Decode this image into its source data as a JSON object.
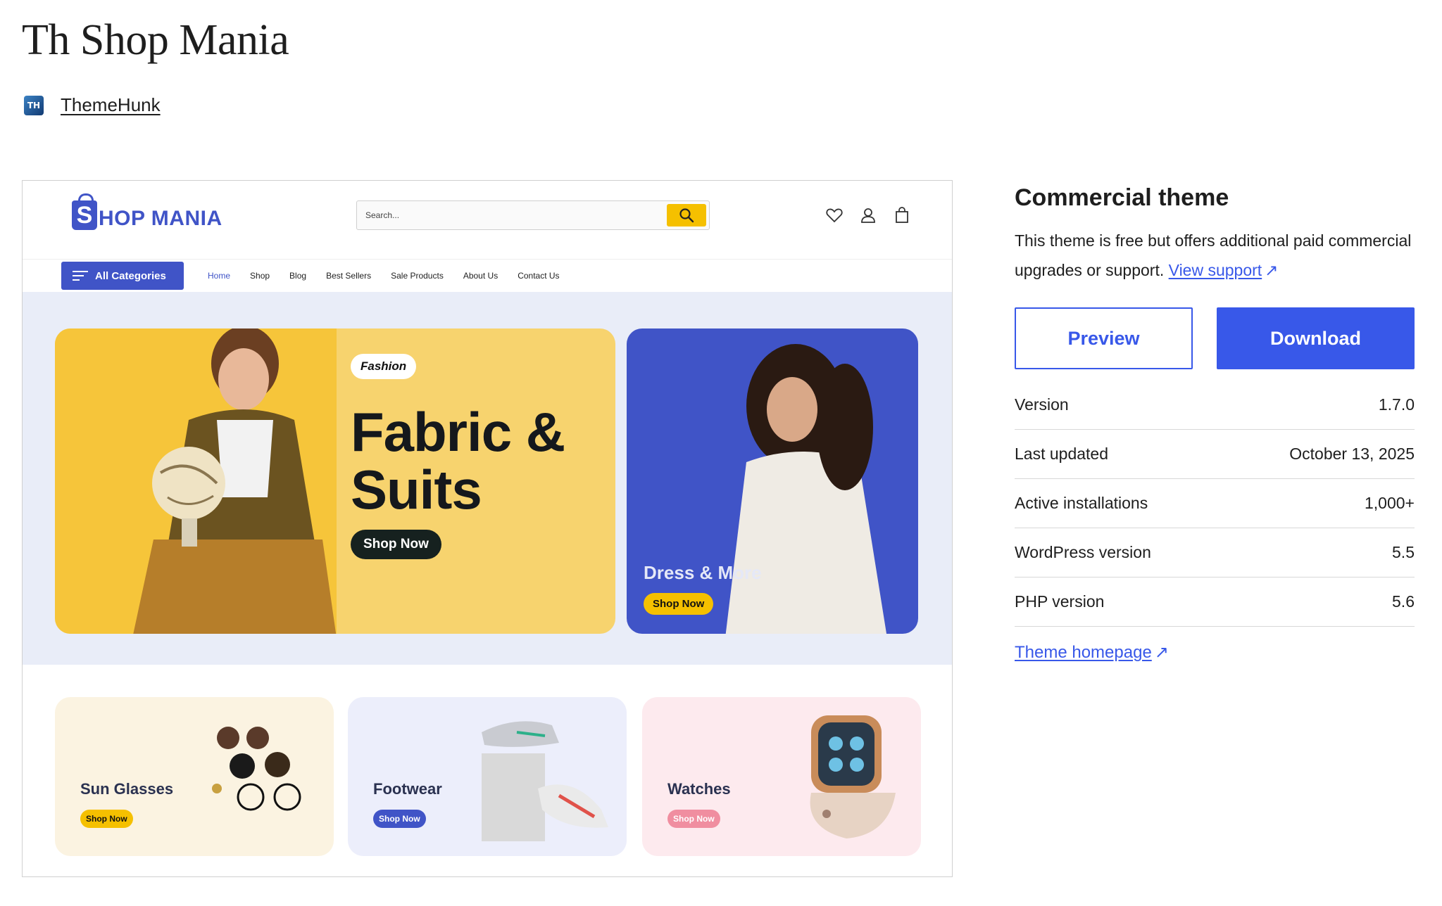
{
  "title": "Th Shop Mania",
  "author": {
    "avatar_text": "TH",
    "name": "ThemeHunk"
  },
  "preview": {
    "logo": {
      "letter": "S",
      "text": "HOP MANIA"
    },
    "search_placeholder": "Search...",
    "all_categories": "All Categories",
    "nav": [
      "Home",
      "Shop",
      "Blog",
      "Best Sellers",
      "Sale Products",
      "About Us",
      "Contact Us"
    ],
    "hero": {
      "tag": "Fashion",
      "title": "Fabric & Suits",
      "button": "Shop Now"
    },
    "promo": {
      "title": "Dress & More",
      "button": "Shop Now"
    },
    "categories": [
      {
        "name": "Sun Glasses",
        "button": "Shop Now",
        "bg": "#fbf3e1",
        "btn_bg": "#f5c000",
        "btn_color": "#111111"
      },
      {
        "name": "Footwear",
        "button": "Shop Now",
        "bg": "#eceefb",
        "btn_bg": "#4054c7",
        "btn_color": "#ffffff"
      },
      {
        "name": "Watches",
        "button": "Shop Now",
        "bg": "#fdeaee",
        "btn_bg": "#f08ea0",
        "btn_color": "#ffffff"
      }
    ]
  },
  "sidebar": {
    "heading": "Commercial theme",
    "description": "This theme is free but offers additional paid commercial upgrades or support.",
    "support_link": "View support",
    "preview_button": "Preview",
    "download_button": "Download",
    "meta": [
      {
        "label": "Version",
        "value": "1.7.0"
      },
      {
        "label": "Last updated",
        "value": "October 13, 2025"
      },
      {
        "label": "Active installations",
        "value": "1,000+"
      },
      {
        "label": "WordPress version",
        "value": "5.5"
      },
      {
        "label": "PHP version",
        "value": "5.6"
      }
    ],
    "homepage_link": "Theme homepage"
  },
  "colors": {
    "accent": "#3858e9",
    "brand": "#4054c7",
    "yellow": "#f5c000"
  }
}
